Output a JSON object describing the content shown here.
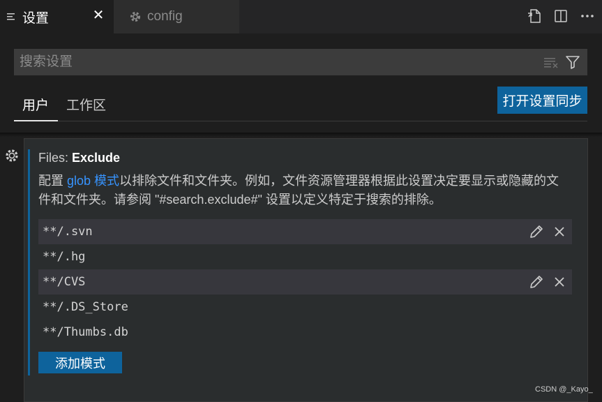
{
  "tabs": [
    {
      "label": "设置",
      "icon": "lines-icon",
      "active": true,
      "close": "✕"
    },
    {
      "label": "config",
      "icon": "gear-icon",
      "active": false
    }
  ],
  "actions": [
    "open-json-icon",
    "split-editor-icon",
    "more-icon"
  ],
  "search": {
    "placeholder": "搜索设置",
    "value": ""
  },
  "scope": {
    "user": "用户",
    "workspace": "工作区"
  },
  "sync_button": "打开设置同步",
  "setting": {
    "title_prefix": "Files: ",
    "title_name": "Exclude",
    "desc_before": "配置 ",
    "desc_link": "glob 模式",
    "desc_after": "以排除文件和文件夹。例如，文件资源管理器根据此设置决定要显示或隐藏的文件和文件夹。请参阅 \"#search.exclude#\" 设置以定义特定于搜索的排除。",
    "patterns": [
      "**/.svn",
      "**/.hg",
      "**/CVS",
      "**/.DS_Store",
      "**/Thumbs.db"
    ],
    "add_button": "添加模式"
  },
  "watermark": "CSDN @_Kayo_",
  "colors": {
    "accent": "#0e639c",
    "link": "#3794ff",
    "background": "#1e1e1e"
  }
}
